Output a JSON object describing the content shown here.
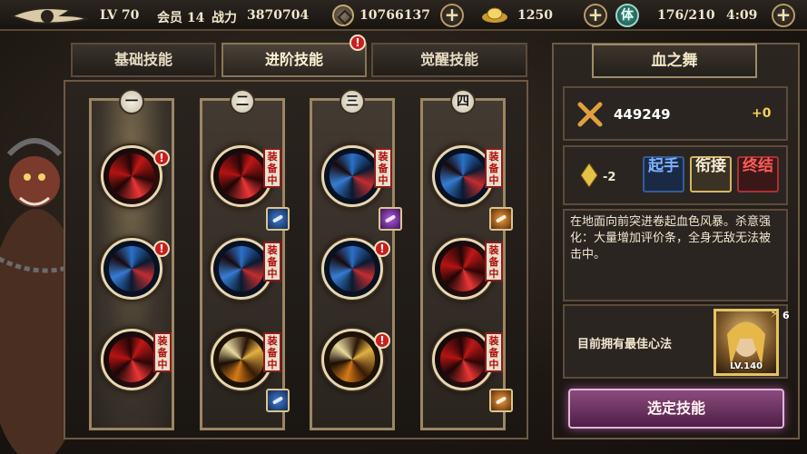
{
  "header": {
    "level": "LV 70",
    "vip": "会员 14",
    "power_label": "战力",
    "power_value": "3870704",
    "silver": "10766137",
    "gold": "1250",
    "stamina_label": "体",
    "stamina": "176/210",
    "time": "4:09"
  },
  "tabs": [
    {
      "label": "基础技能",
      "active": false
    },
    {
      "label": "进阶技能",
      "active": true,
      "alert": "!"
    },
    {
      "label": "觉醒技能",
      "active": false
    }
  ],
  "columns": [
    {
      "num": "一"
    },
    {
      "num": "二"
    },
    {
      "num": "三"
    },
    {
      "num": "四"
    }
  ],
  "badges": {
    "equipped": "装备中",
    "alert": "!"
  },
  "panel": {
    "skill_name": "血之舞",
    "power": "449249",
    "power_bonus": "+0",
    "cost": "-2",
    "combo_tags": [
      "起手",
      "衔接",
      "终结"
    ],
    "description": "在地面向前突进卷起血色风暴。杀意强化：大量增加评价条，全身无敌无法被击中。",
    "best_heart_text": "目前拥有最佳心法",
    "portrait_level": "LV.140",
    "portrait_count": "6",
    "select_button": "选定技能"
  },
  "colors": {
    "accent_gold": "#c4a974",
    "alert_red": "#c81f1f",
    "select_button": "#8c4a7e"
  }
}
